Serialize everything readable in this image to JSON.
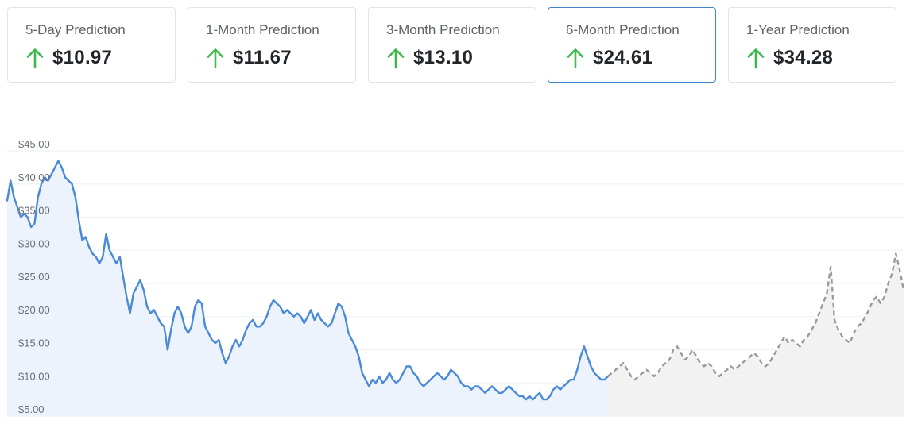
{
  "cards": [
    {
      "label": "5-Day Prediction",
      "value": "$10.97",
      "icon": "arrow-up-icon",
      "active": false
    },
    {
      "label": "1-Month Prediction",
      "value": "$11.67",
      "icon": "arrow-up-icon",
      "active": false
    },
    {
      "label": "3-Month Prediction",
      "value": "$13.10",
      "icon": "arrow-up-icon",
      "active": false
    },
    {
      "label": "6-Month Prediction",
      "value": "$24.61",
      "icon": "arrow-up-icon",
      "active": true
    },
    {
      "label": "1-Year Prediction",
      "value": "$34.28",
      "icon": "arrow-up-icon",
      "active": false
    }
  ],
  "colors": {
    "up_arrow": "#3db84b",
    "active_border": "#3f86c6",
    "historical_line": "#4a8ad8",
    "historical_fill": "#edf3fc",
    "forecast_line": "#9a9a9a",
    "forecast_fill": "#f2f2f2"
  },
  "chart_data": {
    "type": "area",
    "title": "",
    "xlabel": "",
    "ylabel": "",
    "ylim": [
      5,
      45
    ],
    "grid": true,
    "y_ticks": [
      "$5.00",
      "$10.00",
      "$15.00",
      "$20.00",
      "$25.00",
      "$30.00",
      "$35.00",
      "$40.00",
      "$45.00"
    ],
    "series": [
      {
        "style": "solid",
        "values": [
          37.5,
          40.5,
          38,
          36.5,
          35,
          35.5,
          35,
          33.5,
          34,
          38,
          40,
          41,
          40.5,
          41.5,
          42.5,
          43.5,
          42.5,
          41,
          40.5,
          40,
          38,
          34.5,
          31.5,
          32,
          30.5,
          29.5,
          29,
          28,
          29,
          32.5,
          30,
          29,
          28,
          29,
          26,
          23,
          20.5,
          23.5,
          24.5,
          25.5,
          24,
          21.5,
          20.5,
          21,
          20,
          19,
          18.5,
          15,
          18,
          20.5,
          21.5,
          20.5,
          18.5,
          17.5,
          18.5,
          21.5,
          22.5,
          22,
          18.5,
          17.5,
          16.5,
          16,
          16.5,
          14.5,
          13,
          14,
          15.5,
          16.5,
          15.5,
          16.5,
          18,
          19,
          19.5,
          18.5,
          18.5,
          19,
          20,
          21.5,
          22.5,
          22,
          21.5,
          20.5,
          21,
          20.5,
          20,
          20.5,
          20,
          19,
          20,
          21,
          19.5,
          20.5,
          19.5,
          19,
          18.5,
          19,
          20.5,
          22,
          21.5,
          20,
          17.5,
          16.5,
          15.5,
          14,
          11.5,
          10.5,
          9.5,
          10.5,
          10,
          11,
          10,
          10.5,
          11.5,
          10.5,
          10,
          10.5,
          11.5,
          12.5,
          12.5,
          11.5,
          11,
          10,
          9.5,
          10,
          10.5,
          11,
          11.5,
          11,
          10.5,
          11,
          12,
          11.5,
          11,
          10,
          9.5,
          9.5,
          9,
          9.5,
          9.5,
          9,
          8.5,
          9,
          9.5,
          9,
          8.5,
          8.5,
          9,
          9.5,
          9,
          8.5,
          8,
          8,
          7.5,
          8,
          7.5,
          8,
          8.5,
          7.5,
          7.5,
          8,
          9,
          9.5,
          9,
          9.5,
          10,
          10.5,
          10.5,
          12,
          14,
          15.5,
          14,
          12.5,
          11.5,
          11,
          10.5,
          10.5,
          11
        ]
      },
      {
        "style": "dashed",
        "values": [
          11,
          11.5,
          12,
          12.5,
          13,
          12,
          11,
          10.5,
          11,
          11.5,
          12,
          11.5,
          11,
          11.5,
          12.5,
          13,
          13.5,
          15,
          15.5,
          14.5,
          13.5,
          14,
          15,
          14,
          13,
          12.5,
          13,
          12.5,
          11.5,
          11,
          11.5,
          12,
          12.5,
          12,
          12.5,
          13,
          13.5,
          14,
          14.5,
          14,
          13,
          12.5,
          13,
          14,
          15,
          16,
          17,
          16,
          16.5,
          16,
          15.5,
          16.5,
          17,
          18,
          19,
          20.5,
          22,
          23.5,
          27.5,
          19.5,
          18,
          17,
          16.5,
          16,
          17.5,
          18.5,
          19,
          20,
          21,
          22.5,
          23,
          22,
          23,
          25,
          26.5,
          29.5,
          27,
          24
        ]
      }
    ]
  }
}
